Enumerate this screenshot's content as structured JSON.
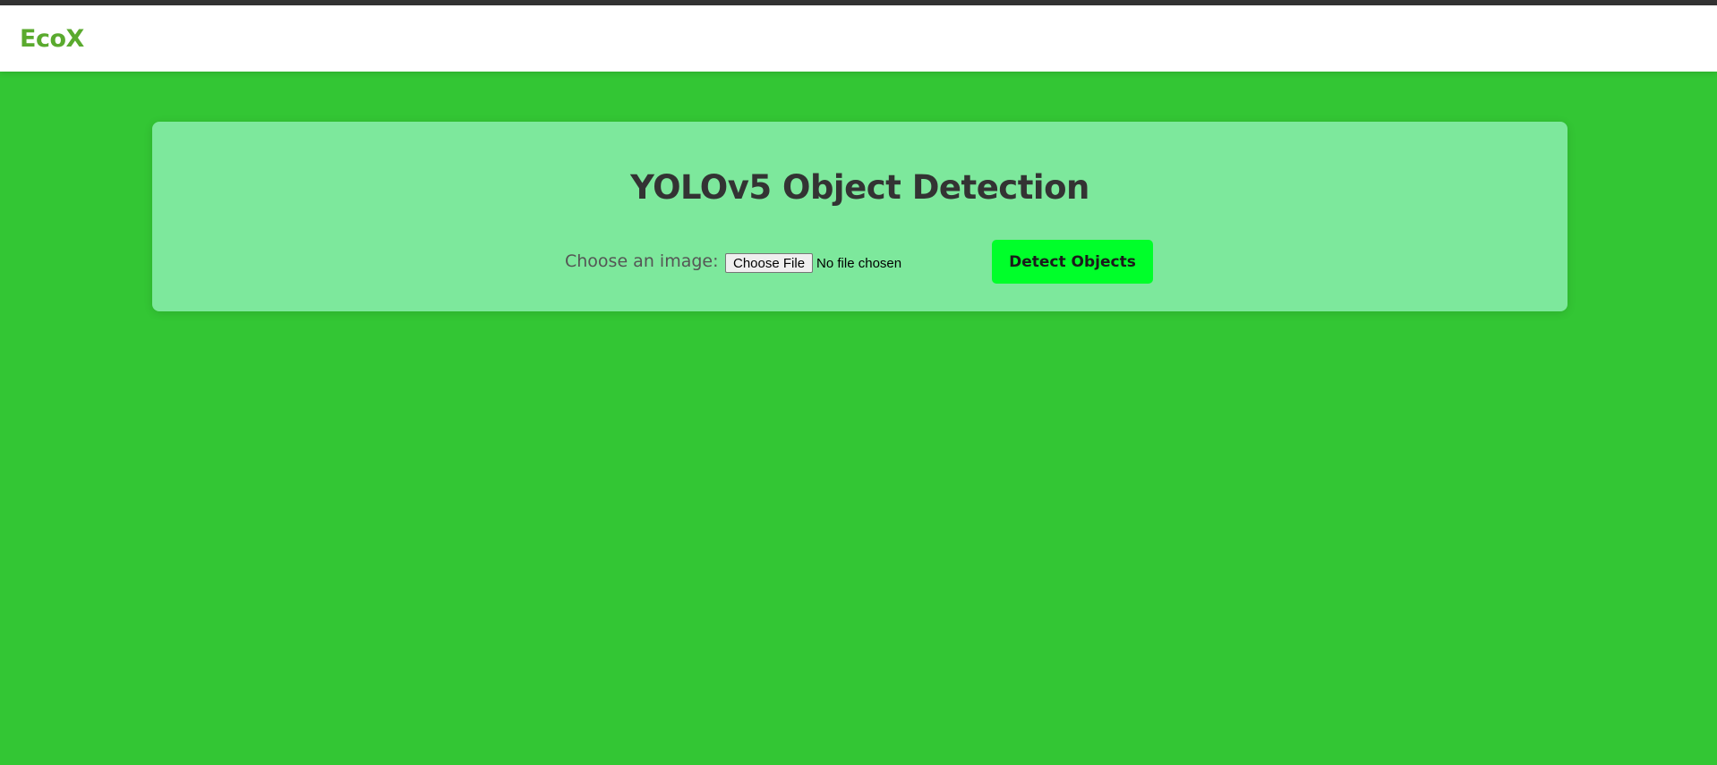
{
  "navbar": {
    "brand": "EcoX"
  },
  "main": {
    "title": "YOLOv5 Object Detection",
    "file_input": {
      "label": "Choose an image:",
      "button_label": "Choose File",
      "status": "No file chosen"
    },
    "detect_button_label": "Detect Objects"
  },
  "colors": {
    "page_background": "#33c634",
    "card_background": "#7de89c",
    "brand_color": "#5aaa2e",
    "detect_button": "#00ff2a",
    "title_text": "#333333"
  }
}
